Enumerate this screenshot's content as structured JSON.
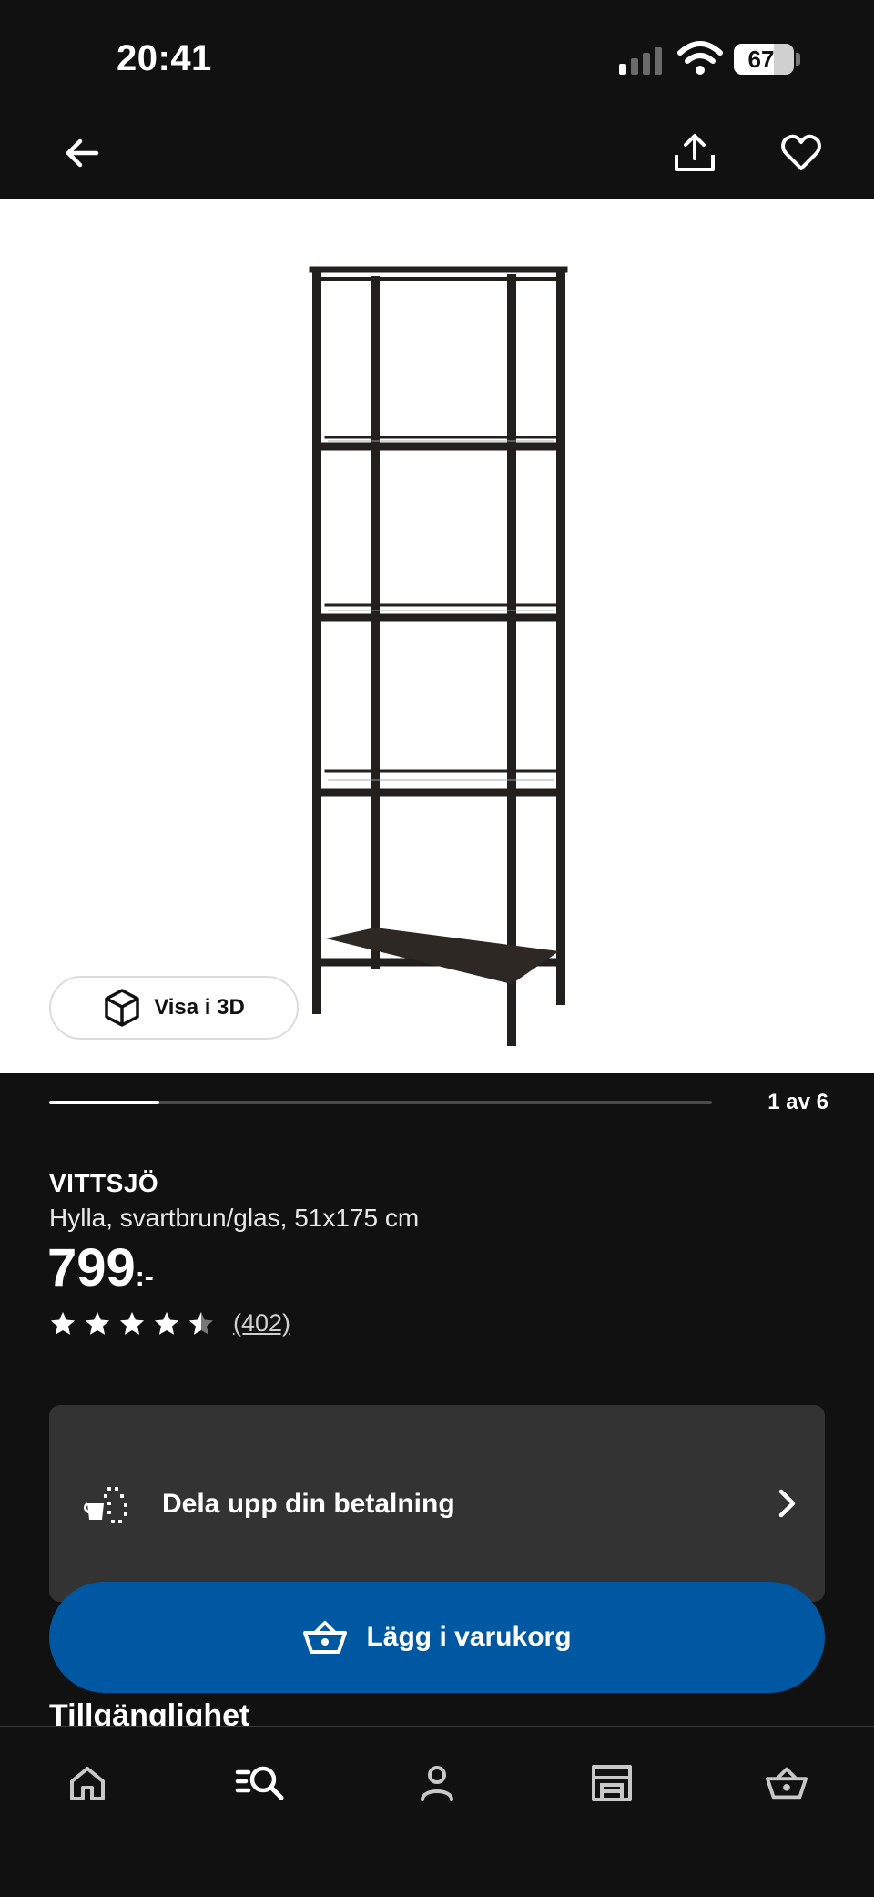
{
  "status_bar": {
    "time": "20:41",
    "battery_percent": "67",
    "battery_level": 0.67
  },
  "nav": {
    "back_icon": "arrow-left-icon",
    "share_icon": "share-icon",
    "favorite_icon": "heart-icon"
  },
  "gallery": {
    "view_3d_label": "Visa i 3D",
    "position_text": "1 av 6",
    "current": 1,
    "total": 6
  },
  "product": {
    "name": "VITTSJÖ",
    "description": "Hylla, svartbrun/glas, 51x175 cm",
    "price": "799",
    "price_suffix": ":-",
    "rating": 4.5,
    "review_count": "(402)"
  },
  "payment_card": {
    "label": "Dela upp din betalning",
    "icon": "split-payment-icon"
  },
  "add_to_cart": {
    "label": "Lägg i varukorg",
    "icon": "basket-icon",
    "color": "#0058a3"
  },
  "availability": {
    "heading": "Tillgänglighet"
  },
  "tabbar": {
    "items": [
      {
        "icon": "home-icon"
      },
      {
        "icon": "search-icon"
      },
      {
        "icon": "profile-icon"
      },
      {
        "icon": "store-icon"
      },
      {
        "icon": "cart-icon"
      }
    ]
  }
}
